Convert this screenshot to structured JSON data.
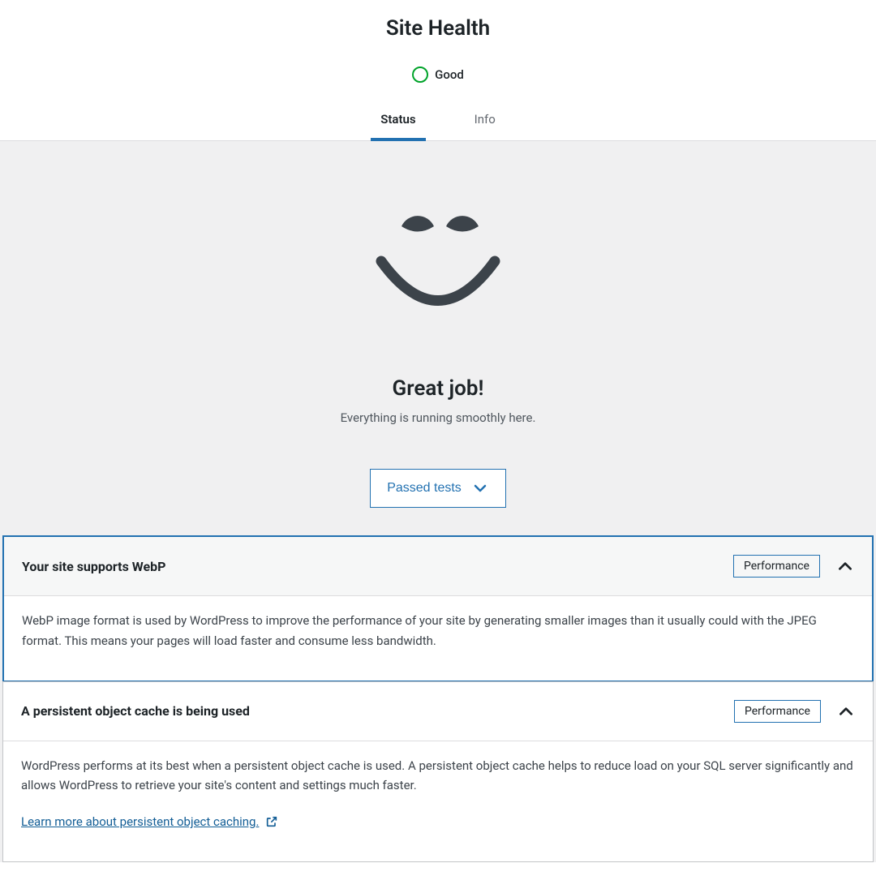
{
  "header": {
    "title": "Site Health",
    "status_label": "Good"
  },
  "tabs": {
    "status": "Status",
    "info": "Info"
  },
  "main": {
    "great_job": "Great job!",
    "subline": "Everything is running smoothly here.",
    "passed_btn": "Passed tests"
  },
  "cards": [
    {
      "title": "Your site supports WebP",
      "badge": "Performance",
      "body": "WebP image format is used by WordPress to improve the performance of your site by generating smaller images than it usually could with the JPEG format. This means your pages will load faster and consume less bandwidth."
    },
    {
      "title": "A persistent object cache is being used",
      "badge": "Performance",
      "body": "WordPress performs at its best when a persistent object cache is used. A persistent object cache helps to reduce load on your SQL server significantly and allows WordPress to retrieve your site's content and settings much faster.",
      "link": "Learn more about persistent object caching."
    }
  ]
}
